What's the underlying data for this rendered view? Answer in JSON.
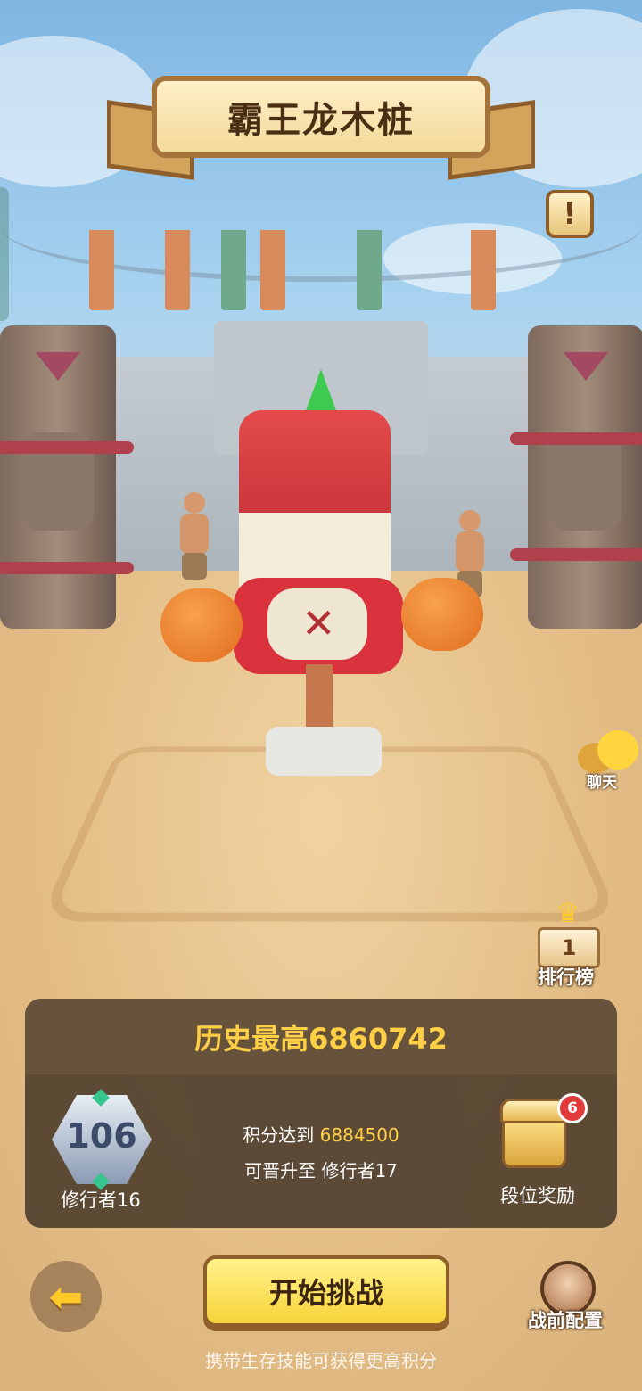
{
  "title": "霸王龙木桩",
  "top_right": {
    "info_icon": "exclamation-icon",
    "info_glyph": "!"
  },
  "side": {
    "chat_label": "聊天",
    "leaderboard_label": "排行榜",
    "leaderboard_podium_number": "1"
  },
  "panel": {
    "best_score": "历史最高6860742",
    "rank": {
      "level_number": "106",
      "name": "修行者16"
    },
    "requirement": {
      "line1_prefix": "积分达到",
      "target_score": "6884500",
      "line2": "可晋升至 修行者17"
    },
    "reward": {
      "label": "段位奖励",
      "badge_count": "6"
    }
  },
  "bottom": {
    "back_icon": "back-arrow-icon",
    "start_label": "开始挑战",
    "loadout_label": "战前配置",
    "tip": "携带生存技能可获得更高积分"
  },
  "colors": {
    "accent_gold": "#ffcf45",
    "button_yellow": "#f7d33a",
    "badge_red": "#e2393a"
  }
}
